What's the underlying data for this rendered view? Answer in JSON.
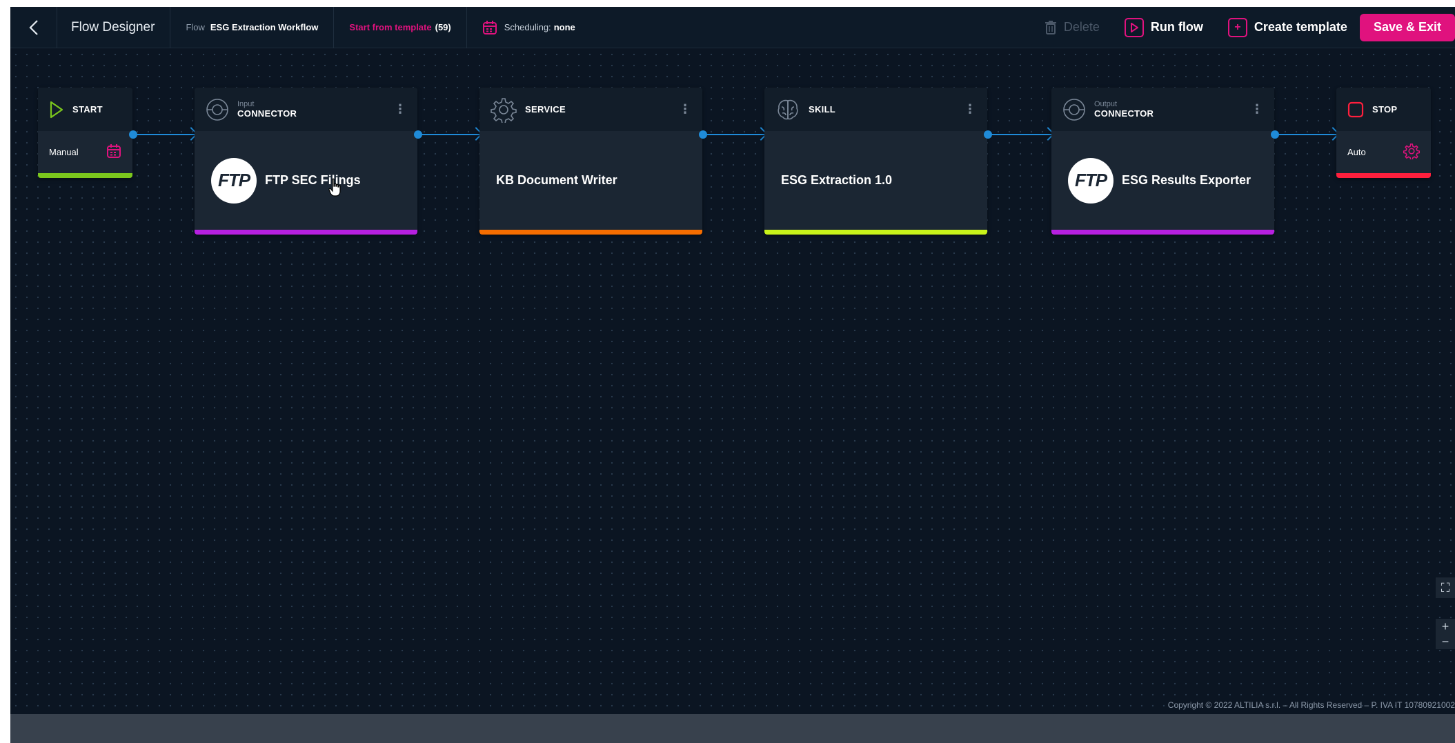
{
  "topbar": {
    "app_title": "Flow Designer",
    "flow_label": "Flow",
    "flow_name": "ESG Extraction Workflow",
    "template_label": "Start from template",
    "template_count": "(59)",
    "scheduling_label": "Scheduling:",
    "scheduling_value": "none",
    "delete_label": "Delete",
    "run_label": "Run flow",
    "create_template_label": "Create template",
    "save_exit_label": "Save & Exit"
  },
  "start": {
    "title": "START",
    "mode": "Manual",
    "bar_color": "#7cc71d"
  },
  "stop": {
    "title": "STOP",
    "mode": "Auto",
    "bar_color": "#ff1f3d"
  },
  "nodes": [
    {
      "sub": "Input",
      "type": "CONNECTOR",
      "logo": "FTP",
      "name": "FTP SEC Filings",
      "bar_color": "#b620e0"
    },
    {
      "sub": "",
      "type": "SERVICE",
      "logo": "",
      "name": "KB Document Writer",
      "bar_color": "#f56d00"
    },
    {
      "sub": "",
      "type": "SKILL",
      "logo": "",
      "name": "ESG Extraction 1.0",
      "bar_color": "#c8f21a"
    },
    {
      "sub": "Output",
      "type": "CONNECTOR",
      "logo": "FTP",
      "name": "ESG Results Exporter",
      "bar_color": "#b620e0"
    }
  ],
  "menu_glyph": "⋮",
  "zoom": {
    "fit": "⛶",
    "in": "+",
    "out": "−"
  },
  "footer": {
    "copyright": "Copyright © 2022 ALTILIA s.r.l. – All Rights Reserved – P. IVA IT 10780921002"
  },
  "colors": {
    "accent": "#e0127e",
    "connector": "#1f8bd8",
    "canvas": "#0b1522"
  }
}
